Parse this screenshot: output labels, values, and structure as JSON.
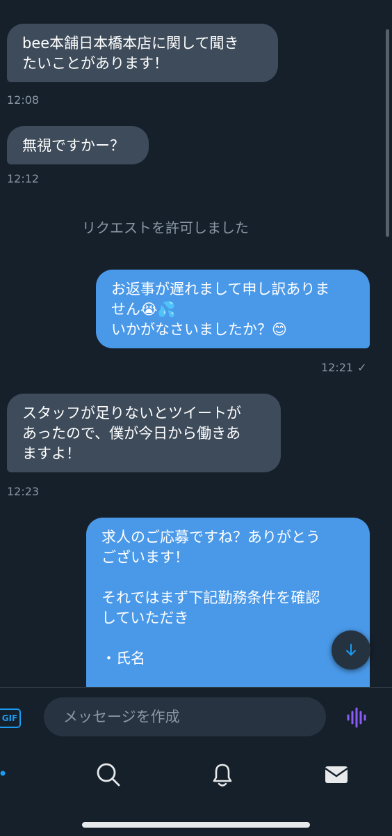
{
  "messages": [
    {
      "text": "bee本舗日本橋本店に関して聞き\nたいことがあります！",
      "time": "12:08"
    },
    {
      "text": "無視ですかー？",
      "time": "12:12"
    },
    {
      "system": "リクエストを許可しました"
    },
    {
      "text": "お返事が遅れまして申し訳ありま\nせん😭💦\nいかがなさいましたか？😊",
      "time": "12:21",
      "status": "✓"
    },
    {
      "text": "スタッフが足りないとツイートが\nあったので、僕が今日から働きあ\nますよ！",
      "time": "12:23"
    },
    {
      "text": "求人のご応募ですね？ありがとう\nございます！\n\nそれではまず下記勤務条件を確認\nしていただき\n\n・氏名"
    }
  ],
  "composer": {
    "gif_label": "GIF",
    "placeholder": "メッセージを作成"
  },
  "icons": {
    "gif": "gif-icon",
    "voice": "voice-message-icon",
    "scroll_down": "arrow-down-icon",
    "home": "home-icon",
    "search": "search-icon",
    "notifications": "bell-icon",
    "messages": "envelope-icon"
  },
  "colors": {
    "background": "#15202b",
    "incoming_bubble": "#3d4b5a",
    "outgoing_bubble": "#4a99e9",
    "accent": "#1d9bf0",
    "voice_icon": "#8b5cf6"
  }
}
